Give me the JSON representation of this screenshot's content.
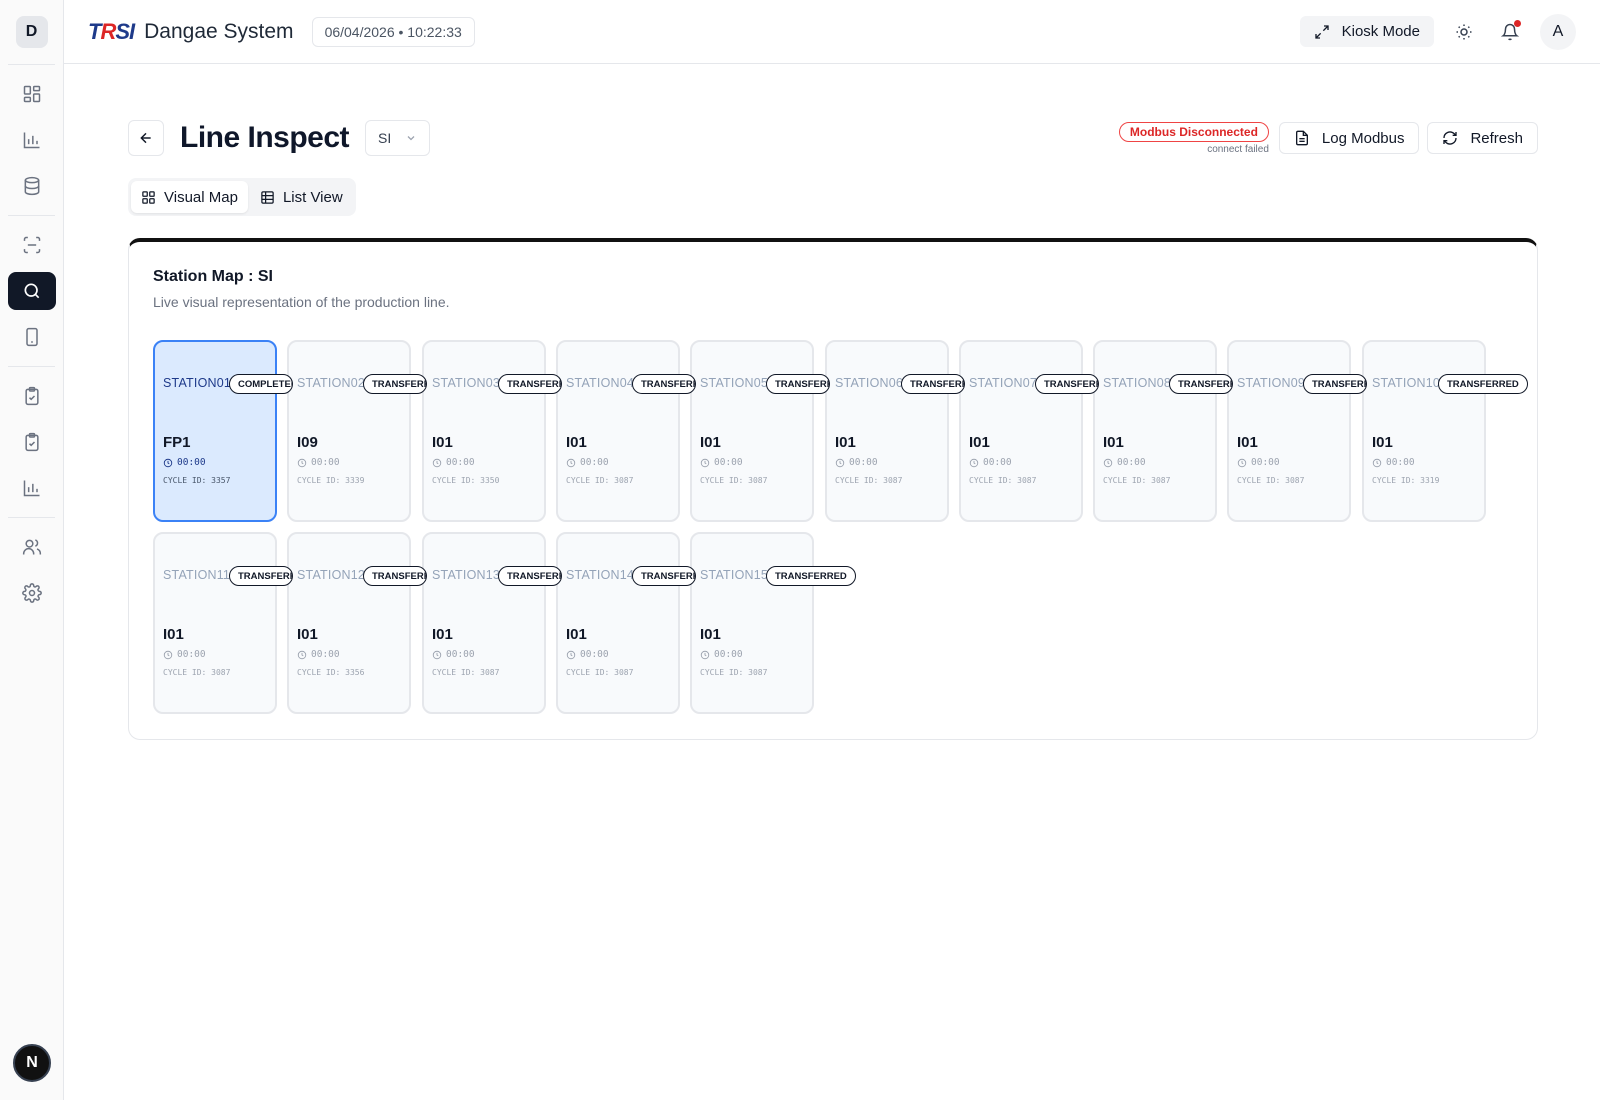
{
  "sidebar": {
    "logo": "D",
    "bottom_avatar": "N"
  },
  "header": {
    "logo_a": "T",
    "logo_b": "R",
    "logo_c": "SI",
    "title": "Dangae System",
    "datetime": "06/04/2026 • 10:22:33",
    "kiosk_label": "Kiosk Mode",
    "user_initial": "A"
  },
  "page": {
    "title": "Line Inspect",
    "line_value": "SI",
    "modbus_status": "Modbus Disconnected",
    "modbus_detail": "connect failed",
    "log_label": "Log Modbus",
    "refresh_label": "Refresh"
  },
  "tabs": [
    {
      "label": "Visual Map",
      "active": true
    },
    {
      "label": "List View",
      "active": false
    }
  ],
  "map": {
    "title": "Station Map : SI",
    "subtitle": "Live visual representation of the production line."
  },
  "stations": [
    {
      "name": "STATION01",
      "status": "COMPLETED",
      "code": "FP1",
      "time": "00:00",
      "cycle": "CYCLE ID: 3357",
      "selected": true
    },
    {
      "name": "STATION02",
      "status": "TRANSFERRED",
      "code": "I09",
      "time": "00:00",
      "cycle": "CYCLE ID: 3339"
    },
    {
      "name": "STATION03",
      "status": "TRANSFERRED",
      "code": "I01",
      "time": "00:00",
      "cycle": "CYCLE ID: 3350"
    },
    {
      "name": "STATION04",
      "status": "TRANSFERRED",
      "code": "I01",
      "time": "00:00",
      "cycle": "CYCLE ID: 3087"
    },
    {
      "name": "STATION05",
      "status": "TRANSFERRED",
      "code": "I01",
      "time": "00:00",
      "cycle": "CYCLE ID: 3087"
    },
    {
      "name": "STATION06",
      "status": "TRANSFERRED",
      "code": "I01",
      "time": "00:00",
      "cycle": "CYCLE ID: 3087"
    },
    {
      "name": "STATION07",
      "status": "TRANSFERRED",
      "code": "I01",
      "time": "00:00",
      "cycle": "CYCLE ID: 3087"
    },
    {
      "name": "STATION08",
      "status": "TRANSFERRED",
      "code": "I01",
      "time": "00:00",
      "cycle": "CYCLE ID: 3087"
    },
    {
      "name": "STATION09",
      "status": "TRANSFERRED",
      "code": "I01",
      "time": "00:00",
      "cycle": "CYCLE ID: 3087"
    },
    {
      "name": "STATION10",
      "status": "TRANSFERRED",
      "code": "I01",
      "time": "00:00",
      "cycle": "CYCLE ID: 3319"
    },
    {
      "name": "STATION11",
      "status": "TRANSFERRED",
      "code": "I01",
      "time": "00:00",
      "cycle": "CYCLE ID: 3087"
    },
    {
      "name": "STATION12",
      "status": "TRANSFERRED",
      "code": "I01",
      "time": "00:00",
      "cycle": "CYCLE ID: 3356"
    },
    {
      "name": "STATION13",
      "status": "TRANSFERRED",
      "code": "I01",
      "time": "00:00",
      "cycle": "CYCLE ID: 3087"
    },
    {
      "name": "STATION14",
      "status": "TRANSFERRED",
      "code": "I01",
      "time": "00:00",
      "cycle": "CYCLE ID: 3087"
    },
    {
      "name": "STATION15",
      "status": "TRANSFERRED",
      "code": "I01",
      "time": "00:00",
      "cycle": "CYCLE ID: 3087"
    }
  ],
  "colors": {
    "accent": "#111827",
    "selected_border": "#3b82f6",
    "selected_bg": "#dbeafe",
    "danger": "#dc2626"
  }
}
